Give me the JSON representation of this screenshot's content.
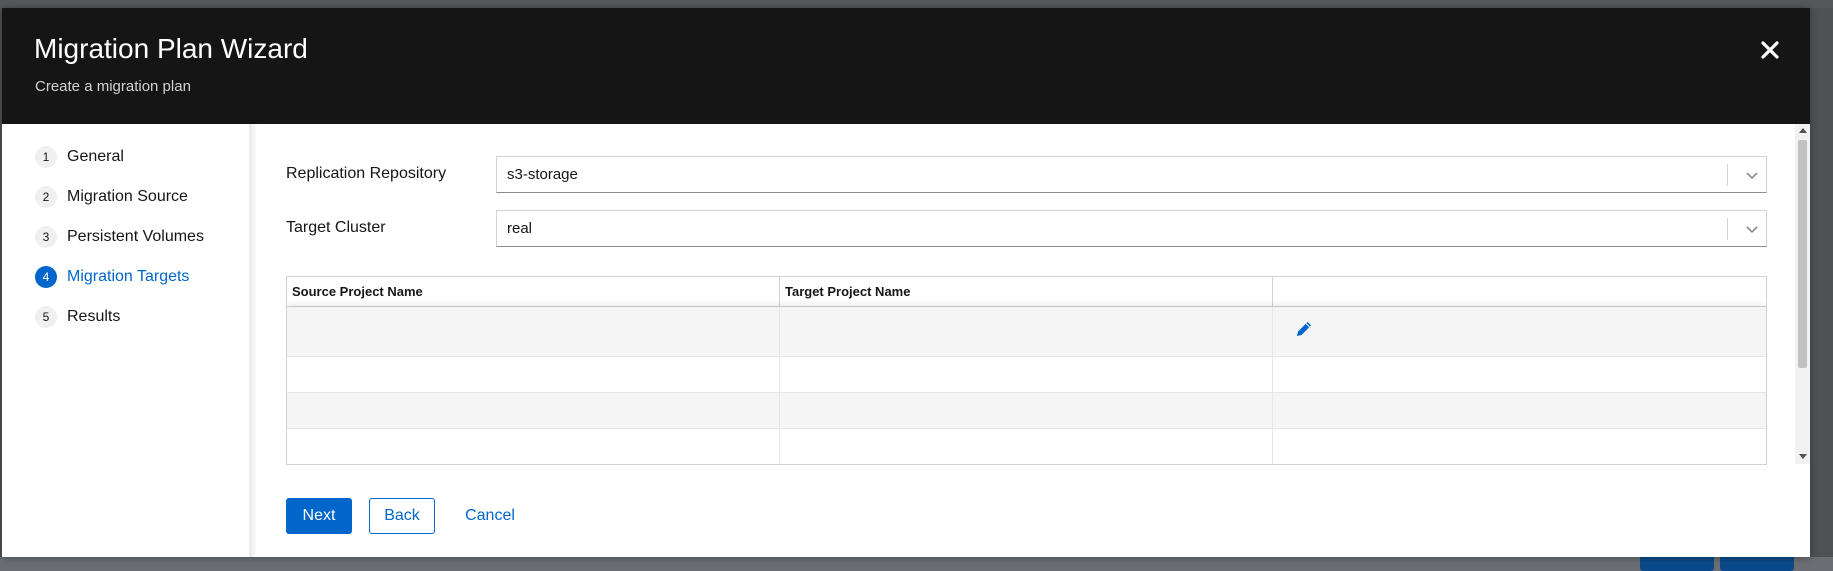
{
  "modal": {
    "title": "Migration Plan Wizard",
    "subtitle": "Create a migration plan",
    "close_icon": "close-icon"
  },
  "steps": [
    {
      "num": "1",
      "label": "General",
      "active": false
    },
    {
      "num": "2",
      "label": "Migration Source",
      "active": false
    },
    {
      "num": "3",
      "label": "Persistent Volumes",
      "active": false
    },
    {
      "num": "4",
      "label": "Migration Targets",
      "active": true
    },
    {
      "num": "5",
      "label": "Results",
      "active": false
    }
  ],
  "form": {
    "replication_repository": {
      "label": "Replication Repository",
      "value": "s3-storage"
    },
    "target_cluster": {
      "label": "Target Cluster",
      "value": "real"
    }
  },
  "table": {
    "columns": [
      "Source Project Name",
      "Target Project Name",
      ""
    ],
    "rows": [
      {
        "source": "",
        "target": "",
        "action_icon": "pencil-icon"
      },
      {
        "source": "",
        "target": ""
      },
      {
        "source": "",
        "target": ""
      },
      {
        "source": "",
        "target": ""
      }
    ]
  },
  "buttons": {
    "next": "Next",
    "back": "Back",
    "cancel": "Cancel"
  },
  "colors": {
    "header_bg": "#151515",
    "accent": "#0066cc"
  }
}
